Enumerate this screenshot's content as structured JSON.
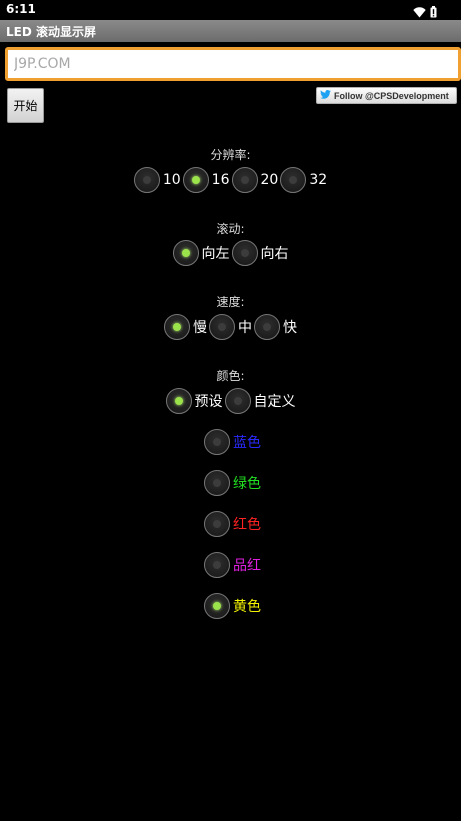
{
  "status_bar": {
    "time": "6:11",
    "icons": [
      "wifi-icon",
      "battery-icon"
    ]
  },
  "app": {
    "title": "LED 滚动显示屏"
  },
  "input": {
    "value": "",
    "placeholder": "J9P.COM"
  },
  "start_button": {
    "label": "开始"
  },
  "twitter_button": {
    "label": "Follow @CPSDevelopment",
    "icon": "twitter-bird-icon",
    "accent": "#1da1f2"
  },
  "resolution": {
    "label": "分辨率:",
    "options": [
      "10",
      "16",
      "20",
      "32"
    ],
    "selected": "16"
  },
  "scroll": {
    "label": "滚动:",
    "options": [
      "向左",
      "向右"
    ],
    "selected": "向左"
  },
  "speed": {
    "label": "速度:",
    "options": [
      "慢",
      "中",
      "快"
    ],
    "selected": "慢"
  },
  "color": {
    "label": "颜色:",
    "mode_options": [
      "预设",
      "自定义"
    ],
    "mode_selected": "预设",
    "presets": [
      {
        "label": "蓝色",
        "color": "#2a2aff"
      },
      {
        "label": "绿色",
        "color": "#22e022"
      },
      {
        "label": "红色",
        "color": "#ff2222"
      },
      {
        "label": "品红",
        "color": "#e020e0"
      },
      {
        "label": "黄色",
        "color": "#f4f400"
      }
    ],
    "preset_selected": "黄色"
  },
  "theme": {
    "background": "#000000",
    "input_border": "#f0a030",
    "radio_on": "#9be34b"
  }
}
